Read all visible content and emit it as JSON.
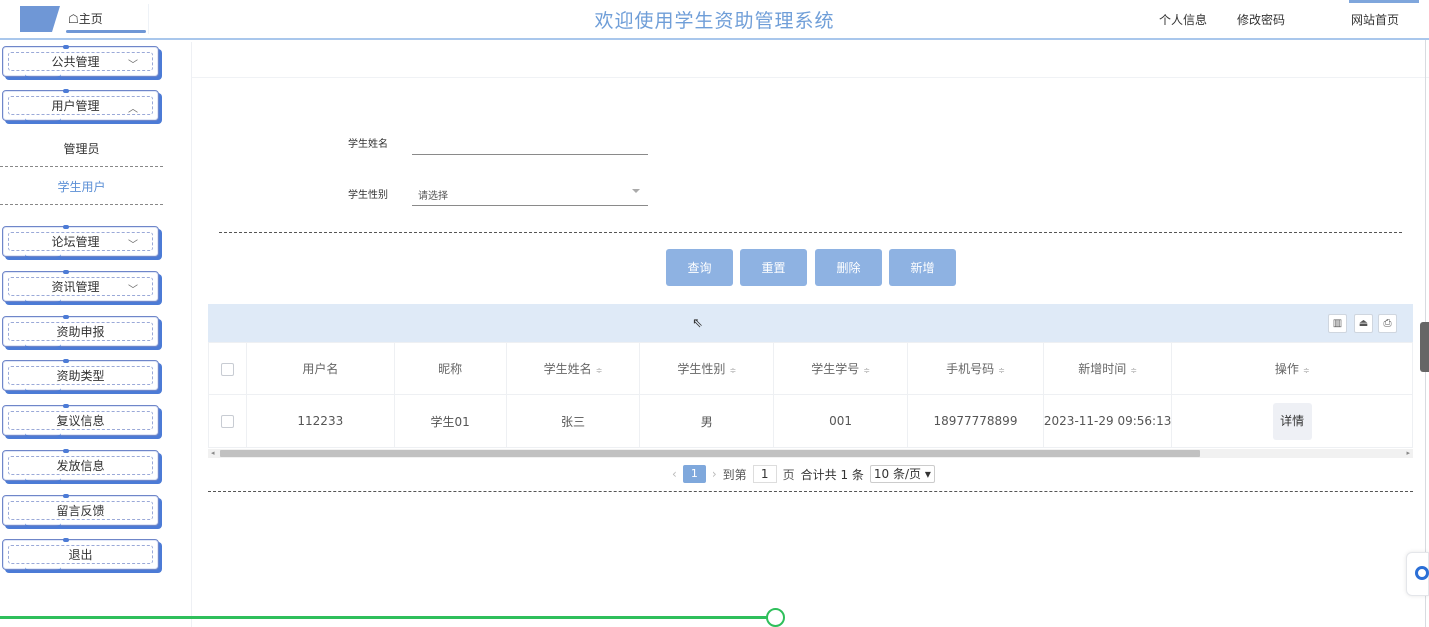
{
  "header": {
    "home_label": "☖主页",
    "title": "欢迎使用学生资助管理系统",
    "links": [
      "个人信息",
      "修改密码",
      "网站首页"
    ]
  },
  "sidebar": {
    "menus": [
      {
        "label": "公共管理",
        "chevron": "﹀"
      },
      {
        "label": "用户管理",
        "chevron": "︿"
      },
      {
        "label": "论坛管理",
        "chevron": "﹀"
      },
      {
        "label": "资讯管理",
        "chevron": "﹀"
      },
      {
        "label": "资助申报"
      },
      {
        "label": "资助类型"
      },
      {
        "label": "复议信息"
      },
      {
        "label": "发放信息"
      },
      {
        "label": "留言反馈"
      },
      {
        "label": "退出"
      }
    ],
    "submenu": [
      {
        "label": "管理员",
        "active": false
      },
      {
        "label": "学生用户",
        "active": true
      }
    ],
    "active_color": "#5b8fd6"
  },
  "search": {
    "name_label": "学生姓名",
    "name_value": "",
    "gender_label": "学生性别",
    "gender_placeholder": "请选择"
  },
  "actions": [
    "查询",
    "重置",
    "删除",
    "新增"
  ],
  "toolbar_icons": [
    "columns-icon",
    "export-icon",
    "print-icon"
  ],
  "table": {
    "columns": [
      "用户名",
      "昵称",
      "学生姓名",
      "学生性别",
      "学生学号",
      "手机号码",
      "新增时间",
      "操作"
    ],
    "sortable": [
      false,
      false,
      true,
      true,
      true,
      true,
      true,
      true
    ],
    "rows": [
      {
        "cells": [
          "112233",
          "学生01",
          "张三",
          "男",
          "001",
          "18977778899",
          "2023-11-29 09:56:13"
        ],
        "action": "详情"
      }
    ]
  },
  "pagination": {
    "current_page": "1",
    "goto_label": "到第",
    "goto_value": "1",
    "page_unit": "页",
    "total": "合计共 1 条",
    "page_size": "10 条/页 ▾"
  },
  "colors": {
    "accent": "#6f9ed8",
    "button": "#8eb2e2",
    "toolbar_bg": "#dfeaf7",
    "progress": "#2fbf5b"
  }
}
